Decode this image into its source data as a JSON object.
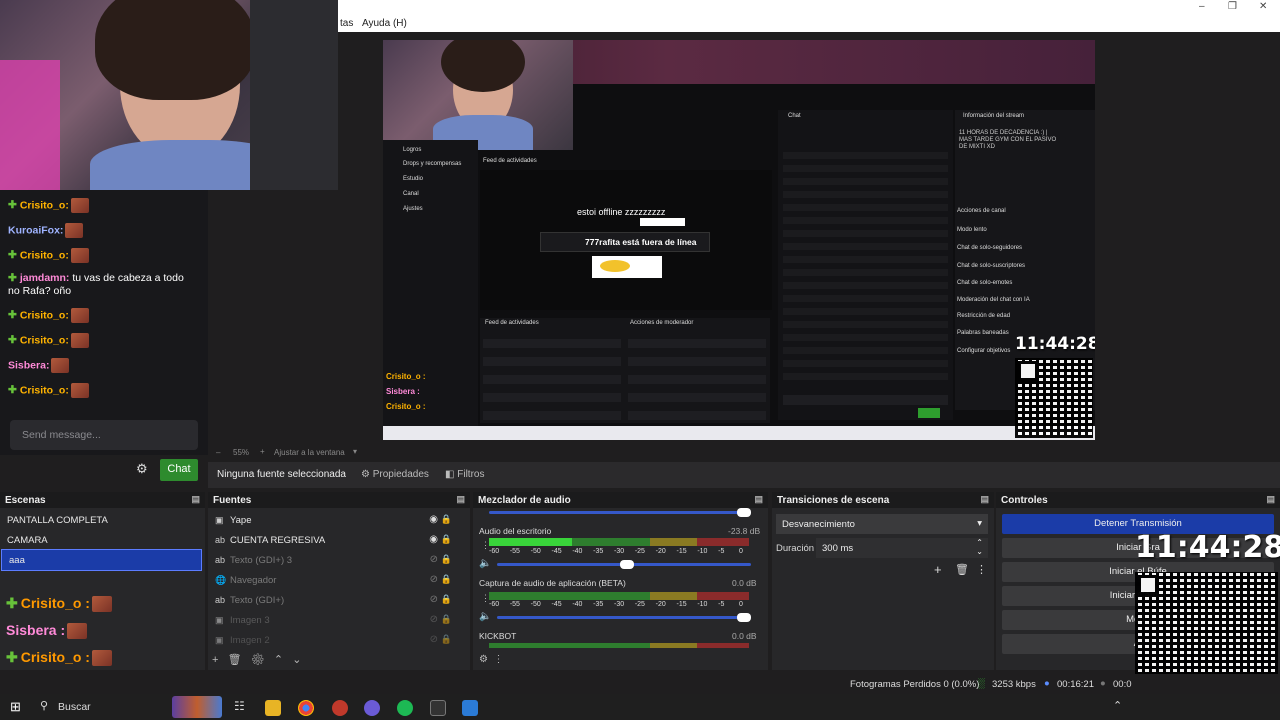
{
  "menubar": {
    "item_partial": "tas",
    "help": "Ayuda (H)"
  },
  "chat_overlay": {
    "messages": [
      {
        "user": "Crisito_o:",
        "text": ""
      },
      {
        "user": "KuroaiFox:",
        "text": ""
      },
      {
        "user": "Crisito_o:",
        "text": ""
      },
      {
        "user": "jamdamn:",
        "text": "tu vas de cabeza a todo no Rafa? oño"
      },
      {
        "user": "Crisito_o:",
        "text": ""
      },
      {
        "user": "Crisito_o:",
        "text": ""
      },
      {
        "user": "Sisbera:",
        "text": ""
      },
      {
        "user": "Crisito_o:",
        "text": ""
      }
    ],
    "input_placeholder": "Send message...",
    "chat_button": "Chat"
  },
  "preview": {
    "offline_title": "estoi offline zzzzzzzzz",
    "offline_status": "777rafita está fuera de línea",
    "chat_title": "Chat",
    "stream_info_title": "Información del stream",
    "stream_desc": "11 HORAS DE DECADENCIA :) | MAS TARDE GYM CON EL PASIVO DE MIXTI XD",
    "feed_title": "Feed de actividades",
    "actions_title": "Acciones de moderador",
    "chat_overlay_mini": [
      "Crisito_o :",
      "Sisbera :",
      "Crisito_o :"
    ],
    "left_nav": [
      "Logros",
      "Drops y recompensas",
      "Estudio",
      "Canal",
      "Ajustes"
    ],
    "right_panel": [
      "Acciones de canal",
      "Modo lento",
      "Chat de solo-seguidores",
      "Chat de solo-suscriptores",
      "Chat de solo-emotes",
      "Moderación del chat con IA",
      "Restricción de edad",
      "Palabras baneadas",
      "Configurar objetivos"
    ],
    "clock": "11:44:28"
  },
  "zoombar": {
    "zoom": "55%",
    "fit": "Ajustar a la ventana"
  },
  "source_toolbar": {
    "no_source": "Ninguna fuente seleccionada",
    "properties": "Propiedades",
    "filters": "Filtros"
  },
  "scenes": {
    "title": "Escenas",
    "items": [
      "PANTALLA COMPLETA",
      "CAMARA",
      "aaa"
    ],
    "selected_index": 2
  },
  "sources": {
    "title": "Fuentes",
    "items": [
      {
        "label": "Yape",
        "icon": "image-icon",
        "visible": true
      },
      {
        "label": "CUENTA REGRESIVA",
        "icon": "text-icon",
        "visible": true
      },
      {
        "label": "Texto (GDI+) 3",
        "icon": "text-icon",
        "visible": false
      },
      {
        "label": "Navegador",
        "icon": "globe-icon",
        "visible": false
      },
      {
        "label": "Texto (GDI+)",
        "icon": "text-icon",
        "visible": false
      },
      {
        "label": "Imagen 3",
        "icon": "image-icon",
        "visible": false
      },
      {
        "label": "Imagen 2",
        "icon": "image-icon",
        "visible": false
      }
    ]
  },
  "bottom_chat": [
    "Crisito_o :",
    "Sisbera :",
    "Crisito_o :"
  ],
  "mixer": {
    "title": "Mezclador de audio",
    "channels": [
      {
        "name": "Audio del escritorio",
        "db": "-23.8 dB",
        "level_fraction": 0.6
      },
      {
        "name": "Captura de audio de aplicación (BETA)",
        "db": "0.0 dB",
        "level_fraction": 1.0
      },
      {
        "name": "KICKBOT",
        "db": "0.0 dB",
        "level_fraction": 1.0
      }
    ],
    "ticks": [
      "-60",
      "-55",
      "-50",
      "-45",
      "-40",
      "-35",
      "-30",
      "-25",
      "-20",
      "-15",
      "-10",
      "-5",
      "0"
    ]
  },
  "transitions": {
    "title": "Transiciones de escena",
    "type": "Desvanecimiento",
    "duration_label": "Duración",
    "duration_value": "300 ms"
  },
  "controls": {
    "title": "Controles",
    "buttons": [
      "Detener Transmisión",
      "Iniciar Grabación",
      "Iniciar el Búfer de Repetición",
      "Iniciar Cámara Virtual",
      "Modo de Estudio",
      "Ajustes"
    ],
    "buttons_visible": [
      "Detener Transmisión",
      "Iniciar Gra",
      "Iniciar el Búfe",
      "Iniciar Cámar",
      "Modo",
      "Aj"
    ],
    "clock": "11:44:28"
  },
  "statusbar": {
    "dropped": "Fotogramas Perdidos 0 (0.0%)",
    "kbps": "3253 kbps",
    "time": "00:16:21",
    "rec_time": "00:0"
  },
  "taskbar": {
    "search": "Buscar"
  },
  "colors": {
    "accent": "#1b3ca8",
    "chat_green": "#2e8b2e",
    "meter_green": "#39d43a"
  }
}
